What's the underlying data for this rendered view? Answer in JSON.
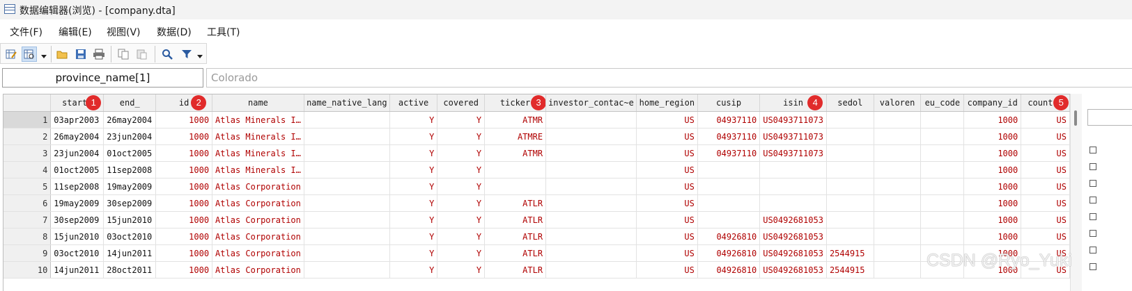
{
  "window": {
    "title": "数据编辑器(浏览) - [company.dta]"
  },
  "menu": [
    "文件(F)",
    "编辑(E)",
    "视图(V)",
    "数据(D)",
    "工具(T)"
  ],
  "toolbar": {
    "icons": [
      "edit-mode-icon",
      "browse-mode-icon",
      "open-folder-icon",
      "save-icon",
      "print-icon",
      "copy-icon",
      "paste-icon",
      "search-icon",
      "filter-icon"
    ]
  },
  "cellbar": {
    "variable": "province_name[1]",
    "value": "Colorado"
  },
  "table": {
    "columns": [
      "start_",
      "end_",
      "id",
      "name",
      "name_native_lang",
      "active",
      "covered",
      "ticker",
      "investor_contac~e",
      "home_region",
      "cusip",
      "isin",
      "sedol",
      "valoren",
      "eu_code",
      "company_id",
      "country"
    ],
    "badges": {
      "start_": "1",
      "id": "2",
      "ticker": "3",
      "isin": "4",
      "country": "5"
    },
    "rows": [
      [
        "1",
        "03apr2003",
        "26may2004",
        "1000",
        "Atlas Minerals I…",
        "",
        "Y",
        "Y",
        "ATMR",
        "",
        "US",
        "04937110",
        "US0493711073",
        "",
        "",
        "",
        "1000",
        "US"
      ],
      [
        "2",
        "26may2004",
        "23jun2004",
        "1000",
        "Atlas Minerals I…",
        "",
        "Y",
        "Y",
        "ATMRE",
        "",
        "US",
        "04937110",
        "US0493711073",
        "",
        "",
        "",
        "1000",
        "US"
      ],
      [
        "3",
        "23jun2004",
        "01oct2005",
        "1000",
        "Atlas Minerals I…",
        "",
        "Y",
        "Y",
        "ATMR",
        "",
        "US",
        "04937110",
        "US0493711073",
        "",
        "",
        "",
        "1000",
        "US"
      ],
      [
        "4",
        "01oct2005",
        "11sep2008",
        "1000",
        "Atlas Minerals I…",
        "",
        "Y",
        "Y",
        "",
        "",
        "US",
        "",
        "",
        "",
        "",
        "",
        "1000",
        "US"
      ],
      [
        "5",
        "11sep2008",
        "19may2009",
        "1000",
        "Atlas Corporation",
        "",
        "Y",
        "Y",
        "",
        "",
        "US",
        "",
        "",
        "",
        "",
        "",
        "1000",
        "US"
      ],
      [
        "6",
        "19may2009",
        "30sep2009",
        "1000",
        "Atlas Corporation",
        "",
        "Y",
        "Y",
        "ATLR",
        "",
        "US",
        "",
        "",
        "",
        "",
        "",
        "1000",
        "US"
      ],
      [
        "7",
        "30sep2009",
        "15jun2010",
        "1000",
        "Atlas Corporation",
        "",
        "Y",
        "Y",
        "ATLR",
        "",
        "US",
        "",
        "US0492681053",
        "",
        "",
        "",
        "1000",
        "US"
      ],
      [
        "8",
        "15jun2010",
        "03oct2010",
        "1000",
        "Atlas Corporation",
        "",
        "Y",
        "Y",
        "ATLR",
        "",
        "US",
        "04926810",
        "US0492681053",
        "",
        "",
        "",
        "1000",
        "US"
      ],
      [
        "9",
        "03oct2010",
        "14jun2011",
        "1000",
        "Atlas Corporation",
        "",
        "Y",
        "Y",
        "ATLR",
        "",
        "US",
        "04926810",
        "US0492681053",
        "2544915",
        "",
        "",
        "1000",
        "US"
      ],
      [
        "10",
        "14jun2011",
        "28oct2011",
        "1000",
        "Atlas Corporation",
        "",
        "Y",
        "Y",
        "ATLR",
        "",
        "US",
        "04926810",
        "US0492681053",
        "2544915",
        "",
        "",
        "1000",
        "US"
      ]
    ]
  },
  "watermark": "CSDN @Ryo_Yuki"
}
